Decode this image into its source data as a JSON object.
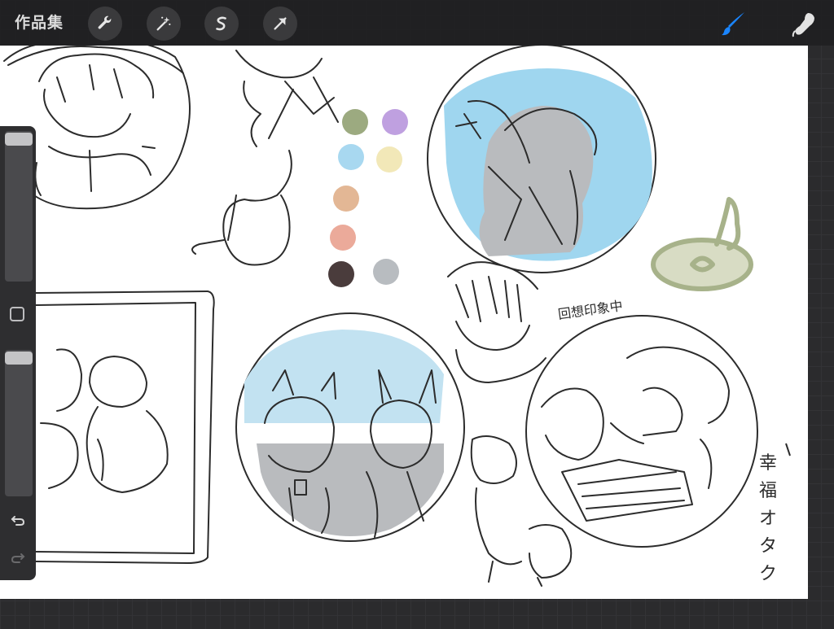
{
  "topbar": {
    "gallery_label": "作品集",
    "tools_left": [
      {
        "name": "actions",
        "icon": "wrench-icon"
      },
      {
        "name": "adjustments",
        "icon": "magic-wand-icon"
      },
      {
        "name": "selection",
        "icon": "selection-s-icon"
      },
      {
        "name": "transform",
        "icon": "arrow-cursor-icon"
      }
    ],
    "tools_right": [
      {
        "name": "brush",
        "icon": "brush-icon",
        "active": true
      },
      {
        "name": "smudge",
        "icon": "smudge-icon"
      }
    ]
  },
  "sidebar": {
    "brush_size_slider": {
      "value": 1.0
    },
    "opacity_slider": {
      "value": 1.0
    },
    "buttons": [
      "modify-square-icon",
      "undo-icon",
      "redo-icon"
    ]
  },
  "canvas": {
    "handwriting_1": "回想印象中",
    "handwriting_2": [
      "幸",
      "福",
      "オ",
      "タ",
      "ク"
    ],
    "palette": [
      "#9caa80",
      "#bfa0e0",
      "#a8d8f0",
      "#f2e8b8",
      "#e3b795",
      "#ebaa9a",
      "#4a3c3c",
      "#b8bcc0"
    ]
  },
  "colors": {
    "sky_blue": "#9fd6ef",
    "sky_blue_light": "#c2e2f1",
    "gray_fill": "#b9bbbe",
    "olive": "#a7b28a",
    "brush_accent": "#1a85ff"
  }
}
